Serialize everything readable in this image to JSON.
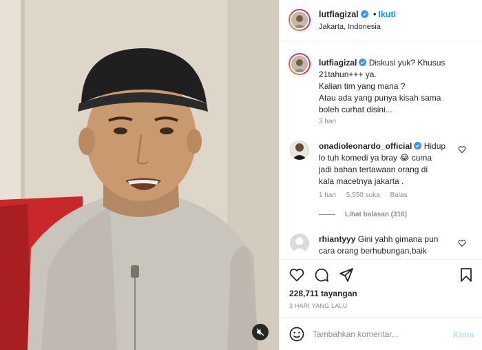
{
  "post": {
    "username": "lutfiagizal",
    "follow_label": "Ikuti",
    "location": "Jakarta, Indonesia",
    "caption": {
      "username": "lutfiagizal",
      "lines": [
        "Diskusi yuk? Khusus",
        "21tahun+++ ya.",
        "Kalian tim yang mana ?",
        "Atau ada yang punya kisah sama",
        "boleh curhat disini..."
      ],
      "time": "3 hari"
    },
    "comments": [
      {
        "username": "onadioleonardo_official",
        "lines": [
          "Hidup",
          "lo tuh komedi ya bray 😂 cuma",
          "jadi bahan tertawaan orang di",
          "kala macetnya jakarta ."
        ],
        "time": "1 hari",
        "likes": "5,550 suka",
        "reply_label": "Balas",
        "view_replies": "Lihat balasan (316)"
      },
      {
        "username": "rhiantyyy",
        "lines": [
          "Gini yahh gimana pun",
          "cara orang berhubungan,baik"
        ]
      }
    ],
    "views": "228,711 tayangan",
    "posted_ago": "3 HARI YANG LALU",
    "add_comment": {
      "placeholder": "Tambahkan komentar...",
      "post_label": "Kirim"
    }
  },
  "icons": {
    "verified": "verified-badge-icon",
    "like": "heart-icon",
    "comment": "comment-icon",
    "share": "paper-plane-icon",
    "save": "bookmark-icon",
    "emoji": "smiley-icon",
    "mute": "speaker-muted-icon"
  },
  "colors": {
    "accent": "#0095f6",
    "verified": "#3897f0",
    "muted_text": "#8e8e8e",
    "post_disabled": "#b2dffc"
  }
}
